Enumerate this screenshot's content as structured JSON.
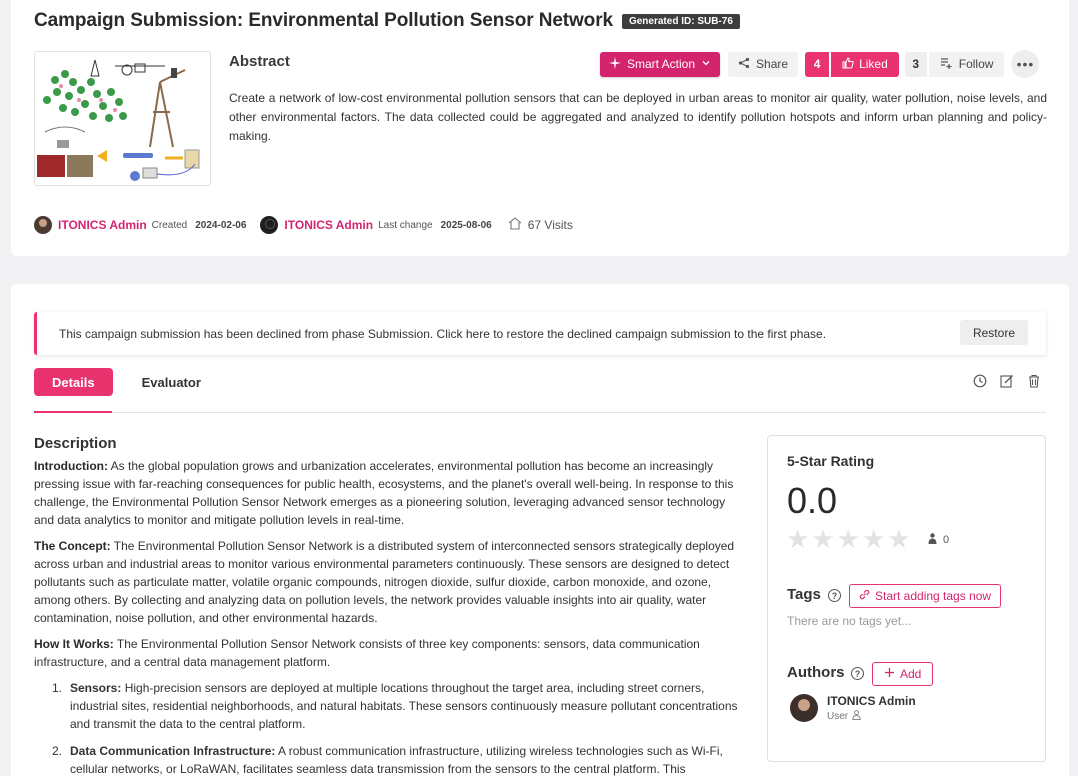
{
  "header": {
    "title": "Campaign Submission: Environmental Pollution Sensor Network",
    "generated_id": "Generated ID: SUB-76"
  },
  "abstract": {
    "heading": "Abstract",
    "text": "Create a network of low-cost environmental pollution sensors that can be deployed in urban areas to monitor air quality, water pollution, noise levels, and other environmental factors. The data collected could be aggregated and analyzed to identify pollution hotspots and inform urban planning and policy-making."
  },
  "actions": {
    "smart_action": "Smart Action",
    "share": "Share",
    "like_count": "4",
    "liked": "Liked",
    "follow_count": "3",
    "follow": "Follow"
  },
  "meta": {
    "creator": "ITONICS Admin",
    "created_label": "Created",
    "created_date": "2024-02-06",
    "modifier": "ITONICS Admin",
    "changed_label": "Last change",
    "changed_date": "2025-08-06",
    "visits": "67 Visits"
  },
  "notice": {
    "text": "This campaign submission has been declined from phase Submission. Click here to restore the declined campaign submission to the first phase.",
    "restore": "Restore"
  },
  "tabs": [
    {
      "label": "Details",
      "active": true
    },
    {
      "label": "Evaluator",
      "active": false
    }
  ],
  "description": {
    "heading": "Description",
    "paragraphs": [
      {
        "lead": "Introduction:",
        "text": " As the global population grows and urbanization accelerates, environmental pollution has become an increasingly pressing issue with far-reaching consequences for public health, ecosystems, and the planet's overall well-being. In response to this challenge, the Environmental Pollution Sensor Network emerges as a pioneering solution, leveraging advanced sensor technology and data analytics to monitor and mitigate pollution levels in real-time."
      },
      {
        "lead": "The Concept:",
        "text": " The Environmental Pollution Sensor Network is a distributed system of interconnected sensors strategically deployed across urban and industrial areas to monitor various environmental parameters continuously. These sensors are designed to detect pollutants such as particulate matter, volatile organic compounds, nitrogen dioxide, sulfur dioxide, carbon monoxide, and ozone, among others. By collecting and analyzing data on pollution levels, the network provides valuable insights into air quality, water contamination, noise pollution, and other environmental hazards."
      },
      {
        "lead": "How It Works:",
        "text": " The Environmental Pollution Sensor Network consists of three key components: sensors, data communication infrastructure, and a central data management platform."
      }
    ],
    "list": [
      {
        "num": "1.",
        "lead": "Sensors:",
        "text": " High-precision sensors are deployed at multiple locations throughout the target area, including street corners, industrial sites, residential neighborhoods, and natural habitats. These sensors continuously measure pollutant concentrations and transmit the data to the central platform."
      },
      {
        "num": "2.",
        "lead": "Data Communication Infrastructure:",
        "text": " A robust communication infrastructure, utilizing wireless technologies such as Wi-Fi, cellular networks, or LoRaWAN, facilitates seamless data transmission from the sensors to the central platform. This infrastructure ensures"
      }
    ]
  },
  "rating": {
    "heading": "5-Star Rating",
    "value": "0.0",
    "stars_filled": 0,
    "stars_total": 5,
    "raters": "0"
  },
  "tags": {
    "heading": "Tags",
    "button": "Start adding tags now",
    "empty": "There are no tags yet..."
  },
  "authors": {
    "heading": "Authors",
    "add": "Add",
    "list": [
      {
        "name": "ITONICS Admin",
        "role": "User"
      }
    ]
  },
  "colors": {
    "accent": "#e8336f",
    "accent_dark": "#d4246e"
  }
}
